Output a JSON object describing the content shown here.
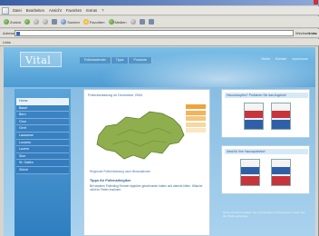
{
  "browser": {
    "menu": [
      "Datei",
      "Bearbeiten",
      "Ansicht",
      "Favoriten",
      "Extras",
      "?"
    ],
    "toolbar": {
      "back": "Zurück",
      "search": "Suchen",
      "favorites": "Favoriten",
      "media": "Medien"
    },
    "address_label": "Adresse",
    "address_value": "",
    "go": "Wechseln zu",
    "links": "Links",
    "linkbar": "Links"
  },
  "site": {
    "logo": "Vital",
    "topnav": [
      "Pollenkalender",
      "Tipps",
      "Produkte"
    ],
    "topnav_right": [
      "Home",
      "Kontakt",
      "Impressum"
    ],
    "sidebar": [
      "Home",
      "Basel",
      "Bern",
      "Chur",
      "Genf",
      "Lausanne",
      "Locarno",
      "Luzern",
      "Sion",
      "St. Gallen",
      "Zürich"
    ],
    "main_title": "Pollenbelastung im Dezember 2004",
    "map_note": "Regionale Pollenbelastung nach Messstationen",
    "tip_title": "Tipps für Pollenallergiker",
    "tip_text": "Bei starkem Pollenflug Fenster tagsüber geschlossen halten und abends lüften. Wäsche nicht im Freien trocknen.",
    "promo1_title": "Heuschnupfen? Probieren Sie das Angebot!",
    "promo2_title": "Ideal für Ihre Hausapotheke!",
    "right_note": "Diese Produkte erhalten Sie in Apotheken und Drogerien. Lesen Sie die Packungsbeilage."
  },
  "colors": {
    "legend": [
      "#f0a23a",
      "#f3b35a",
      "#f5c67e",
      "#f7d89f",
      "#f9e6c2"
    ],
    "map_fill": "#8fae4e"
  }
}
